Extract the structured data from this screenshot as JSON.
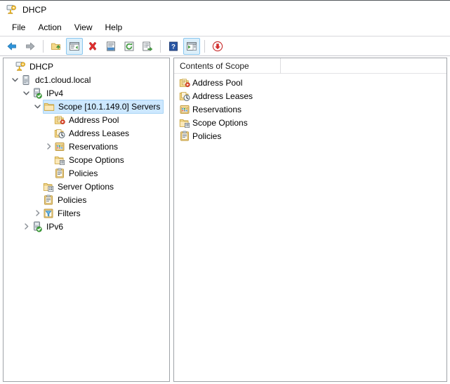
{
  "window": {
    "title": "DHCP",
    "app_icon": "dhcp-server-icon"
  },
  "menubar": {
    "items": [
      {
        "label": "File",
        "name": "menu-file"
      },
      {
        "label": "Action",
        "name": "menu-action"
      },
      {
        "label": "View",
        "name": "menu-view"
      },
      {
        "label": "Help",
        "name": "menu-help"
      }
    ]
  },
  "toolbar": {
    "buttons": [
      {
        "name": "back-button",
        "icon": "back-arrow-icon",
        "active": false,
        "tooltip": "Back"
      },
      {
        "name": "forward-button",
        "icon": "forward-arrow-icon",
        "active": false,
        "tooltip": "Forward"
      },
      {
        "name": "separator-1",
        "icon": "separator",
        "active": false,
        "tooltip": ""
      },
      {
        "name": "up-one-level-button",
        "icon": "folder-up-icon",
        "active": false,
        "tooltip": "Up One Level"
      },
      {
        "name": "show-hide-console-tree-button",
        "icon": "console-tree-icon",
        "active": true,
        "tooltip": "Show/Hide Console Tree"
      },
      {
        "name": "delete-button",
        "icon": "delete-x-icon",
        "active": false,
        "tooltip": "Delete"
      },
      {
        "name": "properties-button",
        "icon": "properties-icon",
        "active": false,
        "tooltip": "Properties"
      },
      {
        "name": "refresh-button",
        "icon": "refresh-icon",
        "active": false,
        "tooltip": "Refresh"
      },
      {
        "name": "export-list-button",
        "icon": "export-list-icon",
        "active": false,
        "tooltip": "Export List"
      },
      {
        "name": "separator-2",
        "icon": "separator",
        "active": false,
        "tooltip": ""
      },
      {
        "name": "help-button",
        "icon": "help-question-icon",
        "active": false,
        "tooltip": "Help"
      },
      {
        "name": "show-hide-action-pane-button",
        "icon": "action-pane-icon",
        "active": true,
        "tooltip": "Show/Hide Action Pane"
      },
      {
        "name": "separator-3",
        "icon": "separator",
        "active": false,
        "tooltip": ""
      },
      {
        "name": "download-button",
        "icon": "download-circle-icon",
        "active": false,
        "tooltip": "Download"
      }
    ]
  },
  "tree": {
    "nodes": [
      {
        "label": "DHCP",
        "indent": 0,
        "chevron": "none",
        "icon": "dhcp-root-icon",
        "selected": false,
        "name": "tree-item-dhcp"
      },
      {
        "label": "dc1.cloud.local",
        "indent": 1,
        "chevron": "expanded",
        "icon": "server-icon",
        "selected": false,
        "name": "tree-item-dc1-cloud-local"
      },
      {
        "label": "IPv4",
        "indent": 2,
        "chevron": "expanded",
        "icon": "server-ok-icon",
        "selected": false,
        "name": "tree-item-ipv4"
      },
      {
        "label": "Scope [10.1.149.0] Servers",
        "indent": 3,
        "chevron": "expanded",
        "icon": "folder-icon",
        "selected": true,
        "name": "tree-item-scope-10-1-149-0-servers"
      },
      {
        "label": "Address Pool",
        "indent": 4,
        "chevron": "none",
        "icon": "address-pool-icon",
        "selected": false,
        "name": "tree-item-address-pool"
      },
      {
        "label": "Address Leases",
        "indent": 4,
        "chevron": "none",
        "icon": "address-leases-icon",
        "selected": false,
        "name": "tree-item-address-leases"
      },
      {
        "label": "Reservations",
        "indent": 4,
        "chevron": "collapsed",
        "icon": "reservations-icon",
        "selected": false,
        "name": "tree-item-reservations"
      },
      {
        "label": "Scope Options",
        "indent": 4,
        "chevron": "none",
        "icon": "scope-options-icon",
        "selected": false,
        "name": "tree-item-scope-options"
      },
      {
        "label": "Policies",
        "indent": 4,
        "chevron": "none",
        "icon": "policies-icon",
        "selected": false,
        "name": "tree-item-policies-scope"
      },
      {
        "label": "Server Options",
        "indent": 3,
        "chevron": "none",
        "icon": "server-options-icon",
        "selected": false,
        "name": "tree-item-server-options"
      },
      {
        "label": "Policies",
        "indent": 3,
        "chevron": "none",
        "icon": "policies-icon",
        "selected": false,
        "name": "tree-item-policies-server"
      },
      {
        "label": "Filters",
        "indent": 3,
        "chevron": "collapsed",
        "icon": "filters-icon",
        "selected": false,
        "name": "tree-item-filters"
      },
      {
        "label": "IPv6",
        "indent": 2,
        "chevron": "collapsed",
        "icon": "server-ok-icon",
        "selected": false,
        "name": "tree-item-ipv6"
      }
    ]
  },
  "list": {
    "columns": [
      {
        "label": "Contents of Scope",
        "name": "column-header-contents-of-scope"
      },
      {
        "label": "",
        "name": "column-header-blank"
      }
    ],
    "rows": [
      {
        "label": "Address Pool",
        "icon": "address-pool-icon",
        "name": "list-item-address-pool"
      },
      {
        "label": "Address Leases",
        "icon": "address-leases-icon",
        "name": "list-item-address-leases"
      },
      {
        "label": "Reservations",
        "icon": "reservations-icon",
        "name": "list-item-reservations"
      },
      {
        "label": "Scope Options",
        "icon": "scope-options-icon",
        "name": "list-item-scope-options"
      },
      {
        "label": "Policies",
        "icon": "policies-icon",
        "name": "list-item-policies"
      }
    ]
  },
  "colors": {
    "selection": "#cde8ff",
    "selection_border": "#a8d4f5",
    "toolbar_active": "#dceffa",
    "toolbar_active_border": "#8ac7ef",
    "pane_border": "#9fa3a8",
    "folder_yellow": "#f5d98a",
    "accent_green": "#3ea63a",
    "accent_red": "#cf2a2a"
  }
}
